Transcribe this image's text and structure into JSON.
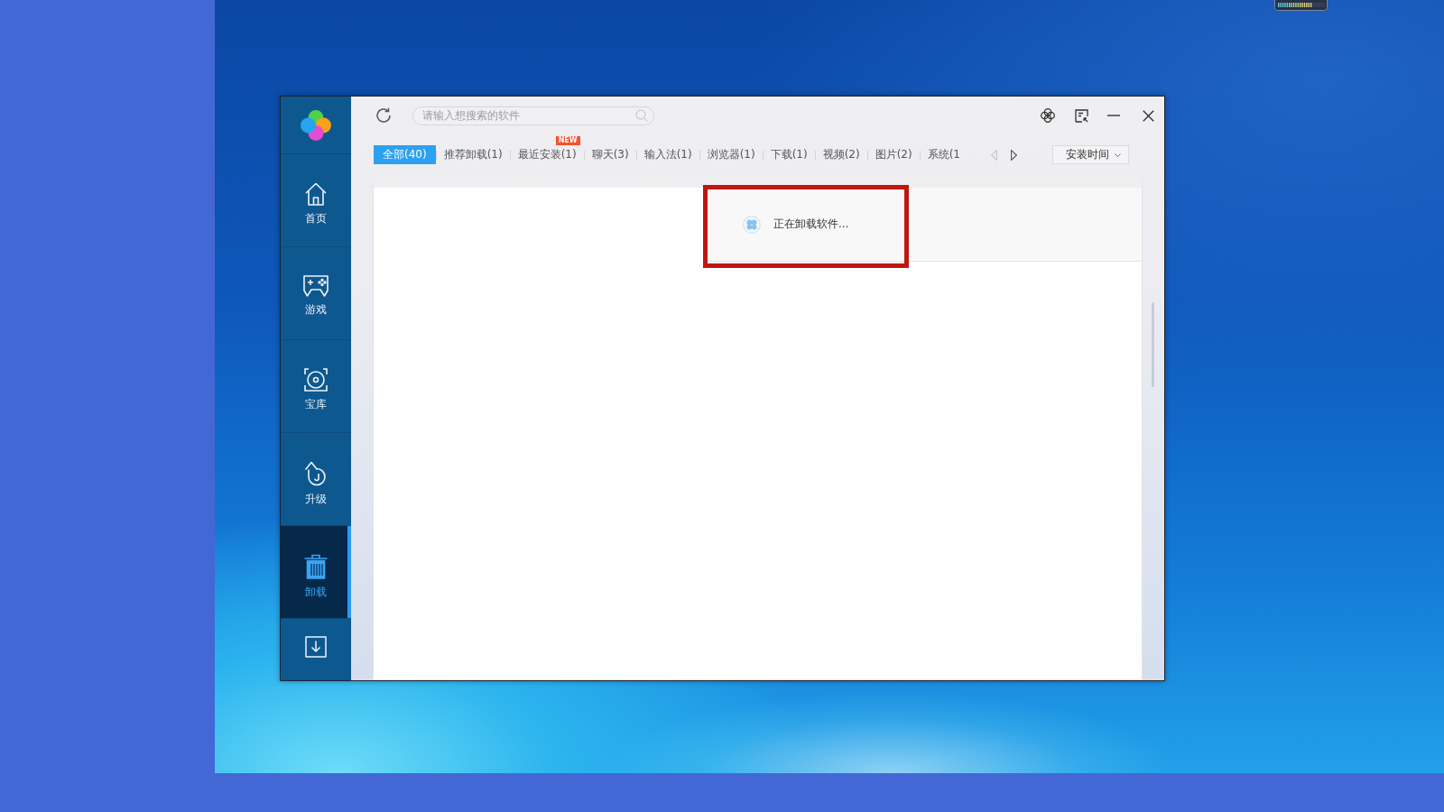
{
  "app_window": {
    "sidebar": {
      "items": [
        {
          "kind": "home",
          "label": "首页",
          "selected": false
        },
        {
          "kind": "games",
          "label": "游戏",
          "selected": false
        },
        {
          "kind": "treasure",
          "label": "宝库",
          "selected": false
        },
        {
          "kind": "upgrade",
          "label": "升级",
          "selected": false
        },
        {
          "kind": "uninstall",
          "label": "卸载",
          "selected": true
        },
        {
          "kind": "download",
          "selected": false
        }
      ]
    },
    "search": {
      "placeholder": "请输入想搜索的软件"
    },
    "tabs": [
      {
        "label": "全部(40)",
        "selected": true
      },
      {
        "label": "推荐卸载(1)",
        "selected": false
      },
      {
        "label": "最近安装(1)",
        "selected": false,
        "badge": "NEW"
      },
      {
        "label": "聊天(3)",
        "selected": false
      },
      {
        "label": "输入法(1)",
        "selected": false
      },
      {
        "label": "浏览器(1)",
        "selected": false
      },
      {
        "label": "下载(1)",
        "selected": false
      },
      {
        "label": "视频(2)",
        "selected": false
      },
      {
        "label": "图片(2)",
        "selected": false
      },
      {
        "label": "系统(1",
        "selected": false
      }
    ],
    "pager": {
      "previous": {
        "disabled": true
      },
      "next": {
        "disabled": false
      }
    },
    "sort": {
      "value": "安装时间"
    },
    "loading": {
      "text": "正在卸载软件..."
    }
  }
}
